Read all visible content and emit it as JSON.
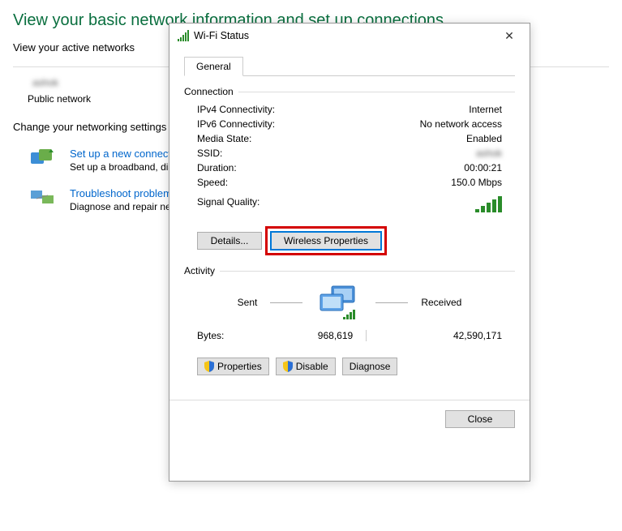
{
  "bg": {
    "title": "View your basic network information and set up connections",
    "active_networks_label": "View your active networks",
    "ssid": "ashok",
    "net_type": "Public network",
    "change_label": "Change your networking settings",
    "link1": "Set up a new connection or network",
    "link1_desc": "Set up a broadband, dial-up, or VPN connection; or set up a router or access point.",
    "link2": "Troubleshoot problems",
    "link2_desc": "Diagnose and repair network problems, or get troubleshooting information."
  },
  "dialog": {
    "title": "Wi-Fi Status",
    "tab_general": "General",
    "connection_title": "Connection",
    "fields": {
      "ipv4_label": "IPv4 Connectivity:",
      "ipv4_value": "Internet",
      "ipv6_label": "IPv6 Connectivity:",
      "ipv6_value": "No network access",
      "media_label": "Media State:",
      "media_value": "Enabled",
      "ssid_label": "SSID:",
      "ssid_value": "ashok",
      "duration_label": "Duration:",
      "duration_value": "00:00:21",
      "speed_label": "Speed:",
      "speed_value": "150.0 Mbps",
      "sigq_label": "Signal Quality:"
    },
    "details_btn": "Details...",
    "wireless_props_btn": "Wireless Properties",
    "activity_title": "Activity",
    "sent_label": "Sent",
    "received_label": "Received",
    "bytes_label": "Bytes:",
    "bytes_sent": "968,619",
    "bytes_recv": "42,590,171",
    "properties_btn": "Properties",
    "disable_btn": "Disable",
    "diagnose_btn": "Diagnose",
    "close_btn": "Close"
  }
}
